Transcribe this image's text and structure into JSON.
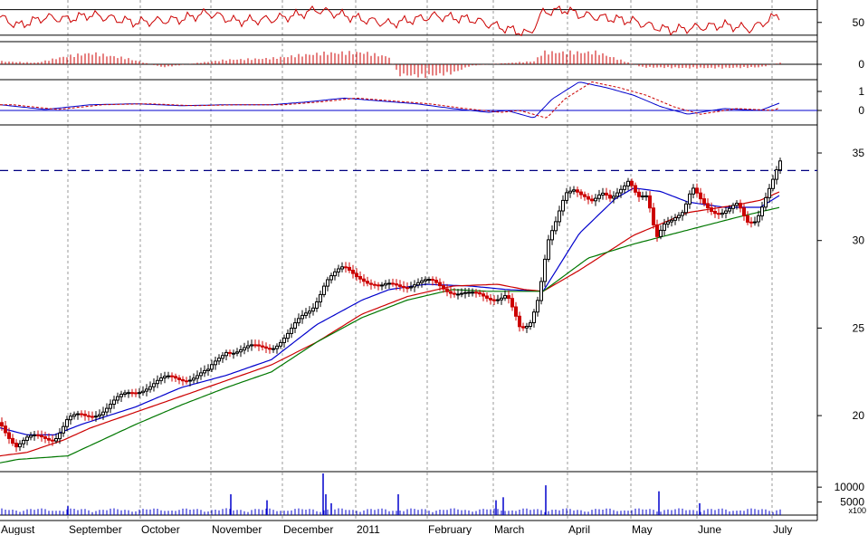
{
  "chart_data": {
    "type": "candlestick",
    "title": "",
    "x_month_labels": [
      "August",
      "September",
      "October",
      "November",
      "December",
      "2011",
      "February",
      "March",
      "April",
      "May",
      "June",
      "July"
    ],
    "price_panel": {
      "y_ticks": [
        "35",
        "30",
        "25",
        "20"
      ],
      "ylim": [
        16.8,
        36.5
      ],
      "resistance_line": 34.0,
      "series": [
        {
          "name": "price",
          "anchors_x": [
            0,
            18,
            30,
            60,
            75,
            95,
            110,
            135,
            160,
            190,
            230,
            250,
            285,
            300,
            320,
            345,
            360,
            380,
            400,
            420,
            440,
            460,
            480,
            500,
            520,
            540,
            560,
            575,
            585,
            595,
            605,
            615,
            625,
            635,
            645,
            655,
            665,
            675,
            685,
            695,
            705,
            715,
            725,
            735,
            745,
            755,
            765,
            775,
            785,
            795,
            805,
            815,
            825,
            835,
            845,
            855,
            862
          ],
          "anchors_y": [
            19.6,
            18.4,
            18.6,
            18.8,
            19.8,
            19.9,
            20.3,
            21.0,
            21.7,
            22.1,
            22.4,
            23.8,
            23.8,
            24.0,
            24.7,
            26.2,
            27.8,
            28.3,
            28.0,
            27.2,
            27.5,
            27.6,
            27.5,
            27.2,
            26.8,
            26.8,
            26.9,
            24.7,
            25.2,
            27.0,
            30.0,
            31.0,
            32.5,
            33.0,
            32.8,
            32.3,
            32.5,
            32.2,
            33.0,
            33.7,
            32.5,
            32.3,
            30.0,
            31.2,
            31.5,
            31.6,
            32.8,
            32.2,
            31.9,
            31.7,
            31.7,
            31.9,
            31.0,
            31.3,
            32.5,
            33.5,
            34.3
          ]
        }
      ],
      "moving_averages": [
        {
          "color": "#0000cc",
          "anchors_x": [
            0,
            30,
            60,
            90,
            150,
            200,
            250,
            300,
            350,
            400,
            430,
            470,
            520,
            560,
            600,
            640,
            680,
            700,
            730,
            760,
            800,
            840,
            862
          ],
          "anchors_y": [
            19.3,
            18.9,
            18.9,
            19.5,
            20.5,
            21.6,
            22.3,
            23.2,
            25.2,
            26.6,
            27.2,
            27.5,
            27.4,
            27.2,
            27.1,
            30.4,
            32.4,
            33.0,
            32.8,
            32.2,
            31.9,
            31.9,
            32.6
          ]
        },
        {
          "color": "#cc0000",
          "anchors_x": [
            0,
            30,
            70,
            100,
            150,
            200,
            250,
            300,
            350,
            400,
            450,
            500,
            550,
            580,
            600,
            640,
            700,
            760,
            810,
            840,
            862
          ],
          "anchors_y": [
            17.7,
            17.9,
            18.6,
            19.3,
            20.2,
            21.1,
            22.0,
            22.9,
            24.2,
            25.8,
            26.8,
            27.4,
            27.5,
            27.2,
            27.1,
            28.3,
            30.3,
            31.6,
            32.0,
            32.3,
            32.8
          ]
        },
        {
          "color": "#007700",
          "anchors_x": [
            0,
            20,
            75,
            100,
            150,
            200,
            250,
            300,
            350,
            400,
            450,
            500,
            540,
            600,
            650,
            700,
            760,
            820,
            862
          ],
          "anchors_y": [
            17.3,
            17.5,
            17.7,
            18.3,
            19.5,
            20.6,
            21.6,
            22.5,
            24.2,
            25.6,
            26.6,
            27.2,
            27.1,
            27.1,
            29.0,
            29.8,
            30.6,
            31.4,
            31.9
          ]
        }
      ]
    },
    "indicator_panels": [
      {
        "name": "rsi",
        "y_ticks": [
          "50"
        ],
        "ylim": [
          20,
          85
        ],
        "guide_levels": [
          70,
          30
        ],
        "anchors_x": [
          0,
          20,
          50,
          75,
          100,
          150,
          200,
          230,
          260,
          300,
          330,
          350,
          400,
          430,
          480,
          520,
          560,
          585,
          600,
          625,
          640,
          700,
          720,
          740,
          800,
          830,
          862
        ],
        "anchors_y": [
          58,
          45,
          58,
          55,
          62,
          50,
          55,
          65,
          52,
          55,
          62,
          70,
          55,
          48,
          60,
          55,
          40,
          32,
          66,
          70,
          62,
          52,
          44,
          38,
          46,
          40,
          63
        ]
      },
      {
        "name": "histogram",
        "y_ticks": [
          "0"
        ],
        "ylim": [
          -1,
          1
        ],
        "anchors_x": [
          0,
          40,
          70,
          100,
          140,
          180,
          220,
          250,
          300,
          330,
          360,
          400,
          430,
          440,
          470,
          500,
          520,
          540,
          590,
          600,
          630,
          660,
          690,
          710,
          760,
          800,
          840,
          862
        ],
        "anchors_y": [
          0.2,
          0.1,
          0.5,
          0.75,
          0.4,
          -0.2,
          0.1,
          0.3,
          0.4,
          0.6,
          0.75,
          0.8,
          0.5,
          -0.7,
          -0.8,
          -0.6,
          -0.1,
          0,
          0.2,
          0.8,
          0.8,
          0.8,
          0.2,
          -0.2,
          -0.25,
          -0.25,
          -0.2,
          0.1
        ]
      },
      {
        "name": "macd",
        "y_ticks": [
          "1",
          "0"
        ],
        "ylim": [
          -0.6,
          1.8
        ],
        "anchors_x": [
          0,
          50,
          100,
          150,
          200,
          250,
          300,
          340,
          380,
          420,
          460,
          500,
          540,
          560,
          590,
          610,
          640,
          670,
          700,
          730,
          760,
          800,
          840,
          862
        ],
        "anchors_y": [
          0.3,
          0.05,
          0.3,
          0.35,
          0.25,
          0.3,
          0.3,
          0.45,
          0.65,
          0.5,
          0.35,
          0.1,
          -0.1,
          0,
          -0.4,
          0.6,
          1.5,
          1.2,
          0.8,
          0.2,
          -0.2,
          0.1,
          0,
          0.4
        ]
      },
      {
        "name": "volume",
        "y_ticks": [
          "10000",
          "5000"
        ],
        "unit_label": "x100",
        "ylim": [
          0,
          14000
        ],
        "spikes_x": [
          75,
          255,
          295,
          357,
          360,
          366,
          440,
          548,
          556,
          603,
          728,
          773
        ],
        "spikes_v": [
          3000,
          7000,
          5000,
          14000,
          7000,
          4000,
          7000,
          5000,
          6000,
          10000,
          8000,
          4000
        ]
      }
    ]
  }
}
